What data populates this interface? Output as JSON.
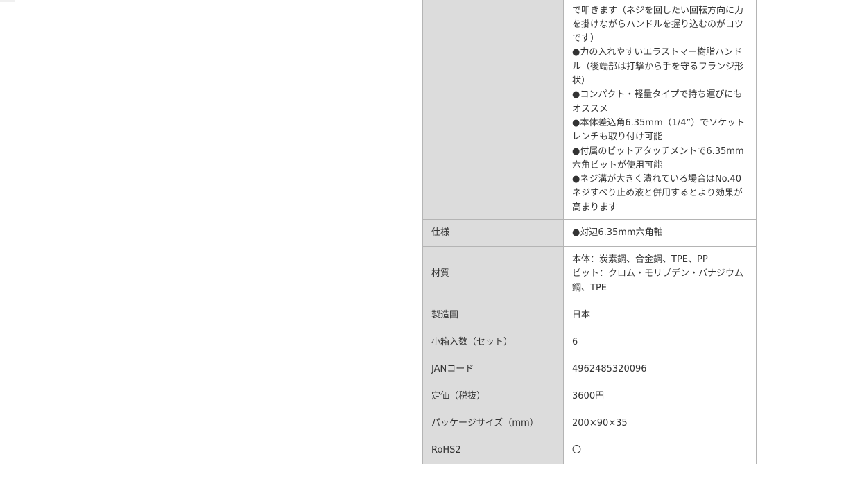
{
  "spec_table": {
    "features": {
      "label": "",
      "value": "で叩きます（ネジを回したい回転方向に力を掛けながらハンドルを握り込むのがコツです）\n●力の入れやすいエラストマー樹脂ハンドル（後端部は打撃から手を守るフランジ形状）\n●コンパクト・軽量タイプで持ち運びにもオススメ\n●本体差込角6.35mm（1/4”）でソケットレンチも取り付け可能\n●付属のビットアタッチメントで6.35mm六角ビットが使用可能\n●ネジ溝が大きく潰れている場合はNo.40ネジすべり止め液と併用するとより効果が高まります"
    },
    "spec": {
      "label": "仕様",
      "value": "●対辺6.35mm六角軸"
    },
    "material": {
      "label": "材質",
      "value": "本体：炭素鋼、合金鋼、TPE、PP\nビット：クロム・モリブデン・バナジウム鋼、TPE"
    },
    "origin": {
      "label": "製造国",
      "value": "日本"
    },
    "box_quantity": {
      "label": "小箱入数（セット）",
      "value": "6"
    },
    "jan_code": {
      "label": "JANコード",
      "value": "4962485320096"
    },
    "list_price": {
      "label": "定価（税抜）",
      "value": "3600円"
    },
    "package_size": {
      "label": "パッケージサイズ（mm）",
      "value": "200×90×35"
    },
    "rohs2": {
      "label": "RoHS2",
      "value": "〇"
    }
  }
}
